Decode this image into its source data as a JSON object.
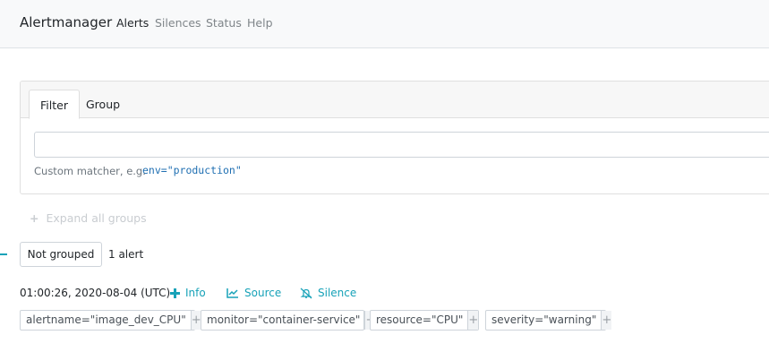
{
  "navbar": {
    "brand": "Alertmanager",
    "links": [
      {
        "label": "Alerts",
        "active": true
      },
      {
        "label": "Silences",
        "active": false
      },
      {
        "label": "Status",
        "active": false
      },
      {
        "label": "Help",
        "active": false
      }
    ]
  },
  "filter": {
    "tabs": [
      "Filter",
      "Group"
    ],
    "active_tab": "Filter",
    "input_value": "",
    "hint_text": "Custom matcher, e.g.",
    "hint_example": "env=\"production\""
  },
  "expand_all": "Expand all groups",
  "group": {
    "button_label": "Not grouped",
    "count_text": "1 alert"
  },
  "alert": {
    "timestamp": "01:00:26, 2020-08-04 (UTC)",
    "actions": {
      "info": "Info",
      "source": "Source",
      "silence": "Silence"
    },
    "labels": [
      "alertname=\"image_dev_CPU\"",
      "monitor=\"container-service\"",
      "resource=\"CPU\"",
      "severity=\"warning\""
    ],
    "label_add_symbol": "+"
  },
  "colors": {
    "accent": "#17a2b8",
    "hint_code": "#1f6fb2",
    "navbar_bg": "#f8f9fa"
  },
  "icons": {
    "info": "plus-icon",
    "source": "chart-line-icon",
    "silence": "bell-slash-icon",
    "expand": "plus-icon"
  }
}
